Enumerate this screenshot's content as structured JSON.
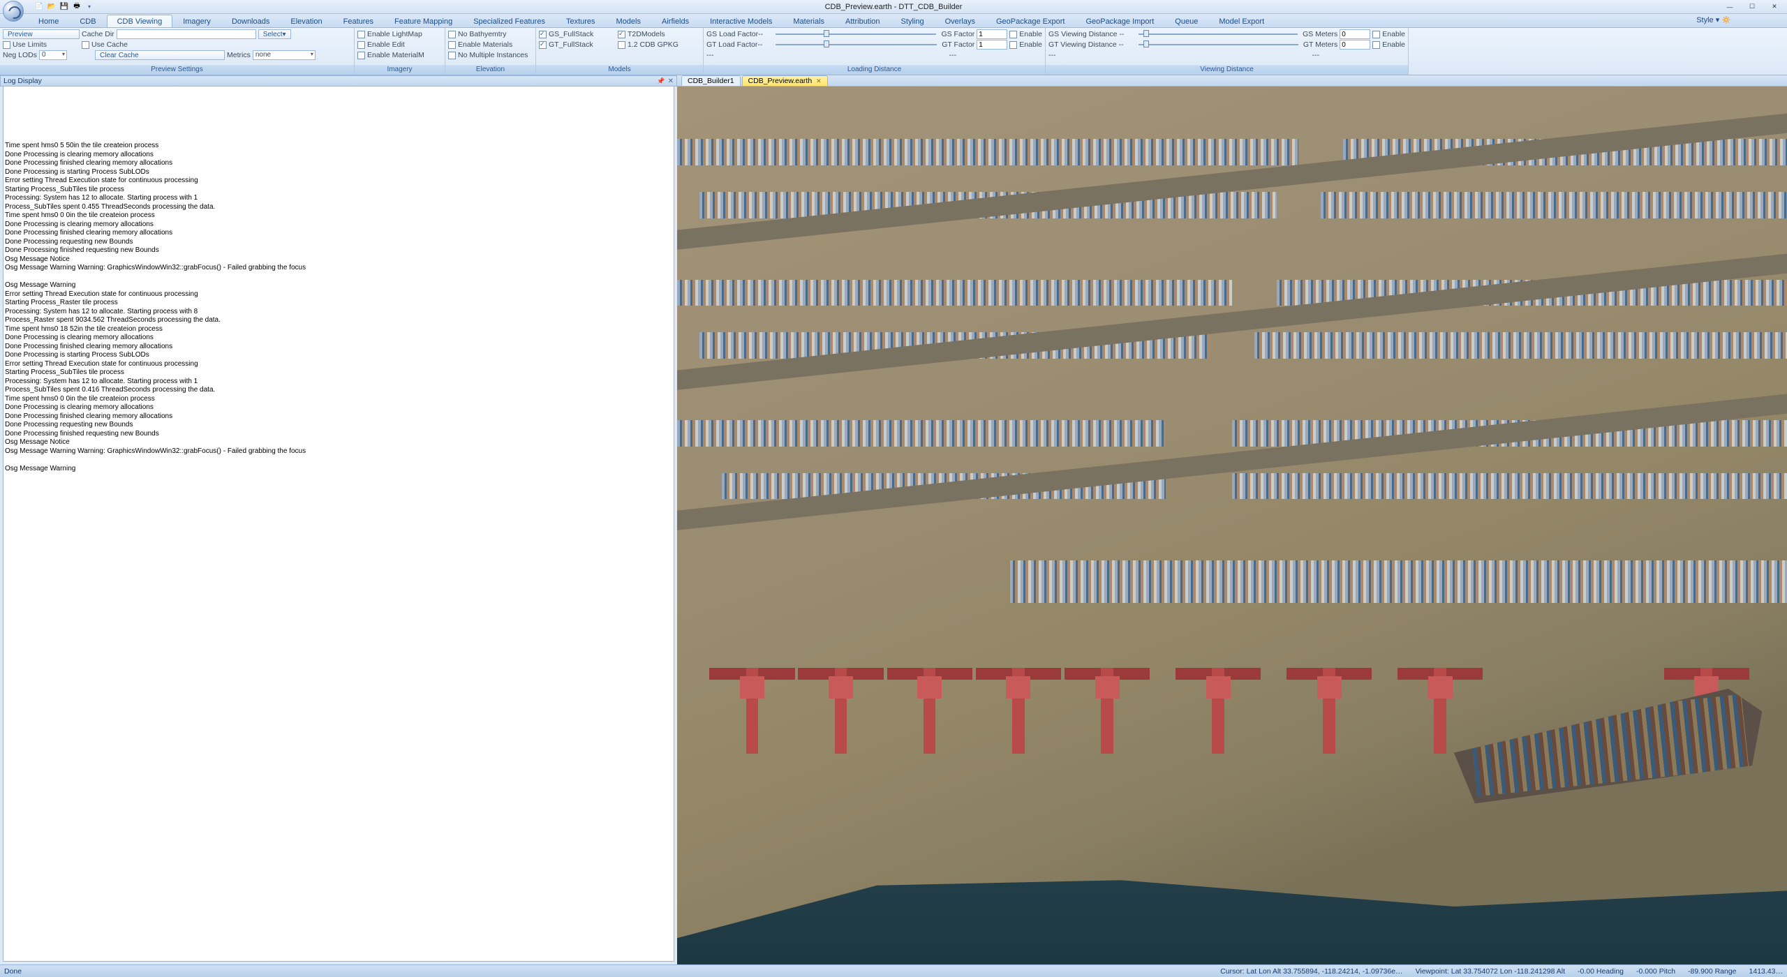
{
  "app": {
    "title": "CDB_Preview.earth - DTT_CDB_Builder",
    "style_label": "Style"
  },
  "window_controls": {
    "min": "—",
    "max": "☐",
    "close": "✕"
  },
  "qat_icons": [
    "new-icon",
    "open-icon",
    "save-icon",
    "print-icon"
  ],
  "tabs": [
    "Home",
    "CDB",
    "CDB Viewing",
    "Imagery",
    "Downloads",
    "Elevation",
    "Features",
    "Feature Mapping",
    "Specialized Features",
    "Textures",
    "Models",
    "Airfields",
    "Interactive Models",
    "Materials",
    "Attribution",
    "Styling",
    "Overlays",
    "GeoPackage Export",
    "GeoPackage Import",
    "Queue",
    "Model Export"
  ],
  "active_tab": 2,
  "ribbon": {
    "preview_settings": {
      "label": "Preview Settings",
      "preview": "Preview",
      "cache_dir": "Cache Dir",
      "select": "Select",
      "use_limits": "Use Limits",
      "use_cache": "Use Cache",
      "neg_lods": "Neg LODs",
      "neg_lods_value": "0",
      "clear_cache": "Clear Cache",
      "metrics": "Metrics",
      "metrics_value": "none"
    },
    "imagery": {
      "label": "Imagery",
      "enable_lightmap": "Enable LightMap",
      "enable_edit": "Enable Edit",
      "enable_materialm": "Enable MaterialM"
    },
    "elevation": {
      "label": "Elevation",
      "no_bathymetry": "No Bathyemtry",
      "enable_materials": "Enable Materials",
      "no_multiple_instances": "No Multiple Instances"
    },
    "models": {
      "label": "Models",
      "gs_fullstack": "GS_FullStack",
      "gt_fullstack": "GT_FullStack",
      "t2dmodels": "T2DModels",
      "cdb_gpkg": "1.2 CDB GPKG"
    },
    "loading_distance": {
      "label": "Loading Distance",
      "gs_load_factor": "GS Load Factor--",
      "gt_load_factor": "GT Load Factor--",
      "gs_factor": "GS Factor",
      "gt_factor": "GT Factor",
      "gs_factor_value": "1",
      "gt_factor_value": "1",
      "enable": "Enable",
      "dash": "---"
    },
    "viewing_distance": {
      "label": "Viewing Distance",
      "gs_viewing_distance": "GS Viewing Distance --",
      "gt_viewing_distance": "GT Viewing Distance --",
      "gs_meters": "GS Meters",
      "gt_meters": "GT Meters",
      "gs_meters_value": "0",
      "gt_meters_value": "0",
      "enable": "Enable",
      "dash": "---"
    }
  },
  "log_panel": {
    "title": "Log Display",
    "lines_block1": [
      "Time spent hms0 5 50in the tile createion process",
      "Done Processing is clearing memory allocations",
      "Done Processing finished clearing memory allocations",
      "Done Processing is starting Process SubLODs",
      "Error setting Thread Execution state for continuous processing",
      "Starting Process_SubTiles tile process",
      "Processing: System has 12 to allocate. Starting process with 1",
      "Process_SubTiles spent 0.455 ThreadSeconds processing the data.",
      "Time spent hms0 0 0in the tile createion process",
      "Done Processing is clearing memory allocations",
      "Done Processing finished clearing memory allocations",
      "Done Processing requesting new Bounds",
      "Done Processing finished requesting new Bounds",
      "Osg Message Notice",
      "Osg Message Warning Warning: GraphicsWindowWin32::grabFocus() - Failed grabbing the focus",
      "",
      "Osg Message Warning",
      "Error setting Thread Execution state for continuous processing",
      "Starting Process_Raster tile process",
      "Processing: System has 12 to allocate. Starting process with 8",
      "Process_Raster spent 9034.562 ThreadSeconds processing the data.",
      "Time spent hms0 18 52in the tile createion process",
      "Done Processing is clearing memory allocations",
      "Done Processing finished clearing memory allocations",
      "Done Processing is starting Process SubLODs",
      "Error setting Thread Execution state for continuous processing",
      "Starting Process_SubTiles tile process",
      "Processing: System has 12 to allocate. Starting process with 1",
      "Process_SubTiles spent 0.416 ThreadSeconds processing the data.",
      "Time spent hms0 0 0in the tile createion process",
      "Done Processing is clearing memory allocations",
      "Done Processing finished clearing memory allocations",
      "Done Processing requesting new Bounds",
      "Done Processing finished requesting new Bounds",
      "Osg Message Notice",
      "Osg Message Warning Warning: GraphicsWindowWin32::grabFocus() - Failed grabbing the focus",
      "",
      "Osg Message Warning"
    ]
  },
  "documents": {
    "tabs": [
      {
        "label": "CDB_Builder1",
        "active": false
      },
      {
        "label": "CDB_Preview.earth",
        "active": true
      }
    ]
  },
  "statusbar": {
    "left": "Done",
    "cursor": "Cursor: Lat Lon Alt 33.755894, -118.24214, -1.09736e…",
    "viewpoint": "Viewpoint: Lat 33.754072 Lon -118.241298 Alt",
    "heading": "-0.00 Heading",
    "pitch": "-0.000 Pitch",
    "range": "-89.900 Range",
    "extra": "1413.43…"
  }
}
